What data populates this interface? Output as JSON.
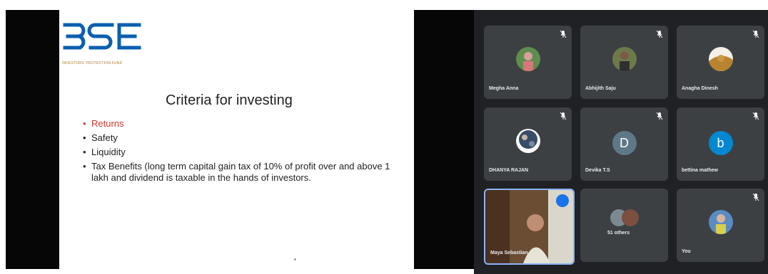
{
  "slide": {
    "logo_text": "BSE",
    "logo_subtitle": "INVESTORS' PROTECTION FUND",
    "title": "Criteria for investing",
    "bullets": [
      {
        "text": "Returns",
        "highlight": true
      },
      {
        "text": "Safety",
        "highlight": false
      },
      {
        "text": "Liquidity",
        "highlight": false
      },
      {
        "text": "Tax Benefits (long term capital gain tax of 10% of profit over and above 1 lakh and dividend is taxable in the hands of investors.",
        "highlight": false
      }
    ]
  },
  "participants": [
    {
      "name": "Megha Anna",
      "avatar": "photo",
      "muted": true
    },
    {
      "name": "Abhijith Saju",
      "avatar": "photo",
      "muted": true
    },
    {
      "name": "Anagha Dinesh",
      "avatar": "photo",
      "muted": true
    },
    {
      "name": "DHANYA RAJAN",
      "avatar": "photo",
      "muted": true
    },
    {
      "name": "Devika T.S",
      "avatar": "letter",
      "letter": "D",
      "color": "#5f7888",
      "muted": true
    },
    {
      "name": "bettina mathew",
      "avatar": "letter",
      "letter": "b",
      "color": "#0288d1",
      "muted": true
    },
    {
      "name": "Maya Sebastian",
      "avatar": "video",
      "speaking": true
    },
    {
      "name": "51 others",
      "avatar": "group"
    },
    {
      "name": "You",
      "avatar": "photo",
      "muted": true
    }
  ],
  "colors": {
    "gallery_bg": "#202124",
    "tile_bg": "#3c4043",
    "active_border": "#8ab4f8",
    "highlight": "#cf3a2a",
    "logo_blue": "#0a5fb0"
  }
}
